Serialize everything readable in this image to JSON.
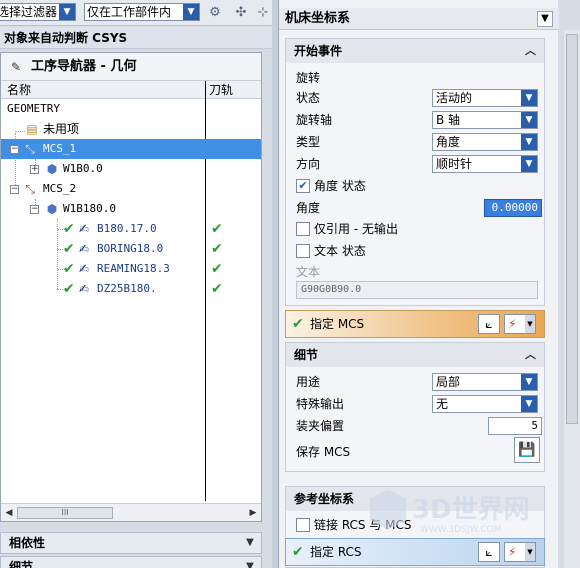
{
  "toolbar": {
    "filter_label": "选择过滤器",
    "scope_value": "仅在工作部件内"
  },
  "auto_detect_label": "对象来自动判断 CSYS",
  "navigator": {
    "title": "工序导航器 - 几何",
    "col_name": "名称",
    "col_path": "刀轨",
    "rows": [
      {
        "label": "GEOMETRY"
      },
      {
        "label": "未用项"
      },
      {
        "label": "MCS_1"
      },
      {
        "label": "W1B0.0"
      },
      {
        "label": "MCS_2"
      },
      {
        "label": "W1B180.0"
      },
      {
        "label": "B180.17.0"
      },
      {
        "label": "BORING18.0"
      },
      {
        "label": "REAMING18.3"
      },
      {
        "label": "DZ25B180."
      }
    ],
    "scroll_thumb": "III"
  },
  "bottom_sections": {
    "dependency": "相依性",
    "details": "细节"
  },
  "dialog": {
    "title": "机床坐标系",
    "start_event": {
      "header": "开始事件",
      "rotation_label": "旋转",
      "state_label": "状态",
      "state_value": "活动的",
      "axis_label": "旋转轴",
      "axis_value": "B 轴",
      "type_label": "类型",
      "type_value": "角度",
      "direction_label": "方向",
      "direction_value": "顺时针",
      "angle_state_label": "角度 状态",
      "angle_state_checked": true,
      "angle_label": "角度",
      "angle_value": "0.00000",
      "ref_only_label": "仅引用 - 无输出",
      "ref_only_checked": false,
      "text_state_label": "文本 状态",
      "text_state_checked": false,
      "text_label": "文本",
      "text_value": "G90G0B90.0"
    },
    "specify_mcs_label": "指定 MCS",
    "details": {
      "header": "细节",
      "usage_label": "用途",
      "usage_value": "局部",
      "special_output_label": "特殊输出",
      "special_output_value": "无",
      "fixture_offset_label": "装夹偏置",
      "fixture_offset_value": "5",
      "save_mcs_label": "保存 MCS"
    },
    "ref_csys": {
      "header": "参考坐标系",
      "link_label": "链接 RCS 与 MCS",
      "link_checked": false,
      "specify_rcs_label": "指定 RCS"
    }
  },
  "colors": {
    "selection": "#3f8fe6",
    "accent_blue": "#2b5ea8",
    "check_green": "#2a9d2a",
    "mcs_bar_orange": "#e9a856"
  }
}
